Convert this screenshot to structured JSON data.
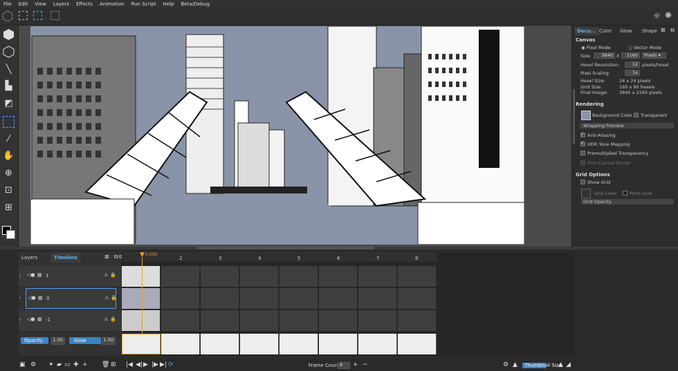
{
  "menu": [
    "File",
    "Edit",
    "View",
    "Layers",
    "Effects",
    "Animation",
    "Run Script",
    "Help",
    "Beta/Debug"
  ],
  "right_panel": {
    "tabs": [
      "Docu...",
      "Color",
      "Glow",
      "Shape"
    ],
    "canvas_heading": "Canvas",
    "pixel_mode": "Pixel Mode",
    "vector_mode": "Vector Mode",
    "size_label": "Size:",
    "size_w": "3840",
    "size_x": "X",
    "size_h": "2160",
    "size_unit": "Pixels",
    "hexel_res_label": "Hexel Resolution:",
    "hexel_res": "12",
    "hexel_res_unit": "pixels/hexel",
    "pixel_scaling_label": "Pixel Scaling:",
    "pixel_scaling": "1x",
    "hexel_size_label": "Hexel Size:",
    "hexel_size": "24 x 24 pixels",
    "grid_size_label": "Grid Size:",
    "grid_size": "160 x 90 hexels",
    "final_image_label": "Final Image:",
    "final_image": "3840 x 2160 pixels",
    "rendering_heading": "Rendering",
    "bg_color": "Background Color",
    "transparent": "Transparent",
    "wrapping_preview": "Wrapping Preview",
    "anti_aliasing": "Anti-Aliasing",
    "hdr": "HDR Tone Mapping",
    "premult": "Premultiplied Transparency",
    "trim": "Trim Canvas Border",
    "grid_heading": "Grid Options",
    "show_grid": "Show Grid",
    "grid_color": "Grid Color",
    "point_grid": "Point-Grid",
    "grid_opacity": "Grid Opacity"
  },
  "layers_panel": {
    "tabs": [
      "Layers",
      "Timeline"
    ],
    "rows": [
      {
        "name": "1"
      },
      {
        "name": "0"
      },
      {
        "name": "-1"
      }
    ],
    "opacity_label": "Opacity",
    "opacity_value": "1.00",
    "glow_label": "Glow",
    "glow_value": "1.00"
  },
  "timeline": {
    "playhead_label": "0.000",
    "frames": [
      "2",
      "3",
      "4",
      "5",
      "6",
      "7",
      "8"
    ]
  },
  "status_bar": {
    "frame_count_label": "Frame Count",
    "frame_count": "8",
    "thumbnail_size": "Thumbnail Size"
  }
}
